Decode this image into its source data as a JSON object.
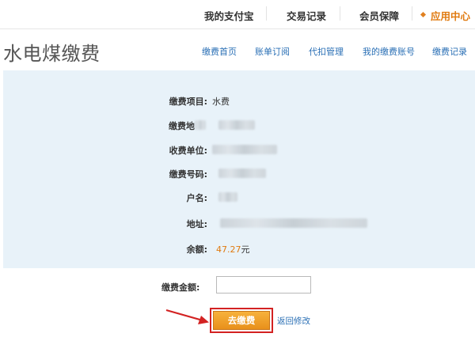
{
  "topnav": {
    "items": [
      {
        "label": "我的支付宝"
      },
      {
        "label": "交易记录"
      },
      {
        "label": "会员保障"
      },
      {
        "label": "应用中心"
      }
    ]
  },
  "page": {
    "title": "水电煤缴费"
  },
  "subnav": {
    "items": [
      {
        "label": "缴费首页"
      },
      {
        "label": "账单订阅"
      },
      {
        "label": "代扣管理"
      },
      {
        "label": "我的缴费账号"
      },
      {
        "label": "缴费记录"
      }
    ]
  },
  "details": {
    "item_label": "缴费项目:",
    "item_value": "水费",
    "area_label": "缴费地",
    "unit_label": "收费单位:",
    "number_label": "缴费号码:",
    "name_label": "户名:",
    "address_label": "地址:",
    "balance_label": "余额:",
    "balance_value": "47.27",
    "balance_unit": "元"
  },
  "form": {
    "amount_label": "缴费金额:",
    "amount_value": "",
    "pay_button": "去缴费",
    "back_link": "返回修改"
  },
  "colors": {
    "accent": "#e07a10",
    "panel_bg": "#e8f2f9",
    "link": "#2a6fb5",
    "highlight_border": "#d32222",
    "arrow": "#d32222"
  }
}
